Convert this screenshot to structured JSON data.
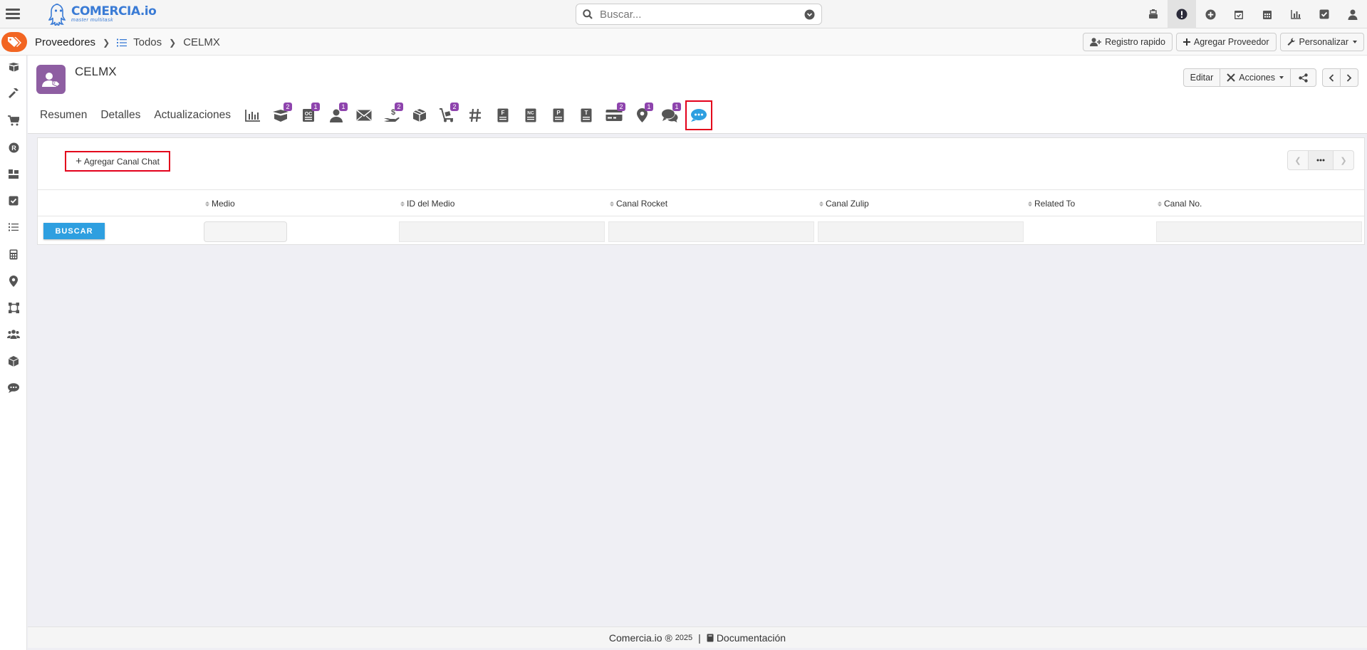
{
  "app": {
    "logo_name": "COMERCIA.io",
    "logo_tagline": "master multitask"
  },
  "search": {
    "placeholder": "Buscar..."
  },
  "top_icons": [
    "cash-register-icon",
    "alert-icon",
    "plus-circle-icon",
    "calendar-check-icon",
    "calendar-icon",
    "chart-icon",
    "checkbox-icon",
    "user-icon"
  ],
  "breadcrumb": {
    "module": "Proveedores",
    "list": "Todos",
    "record": "CELMX"
  },
  "actions": {
    "quick_register": "Registro rapido",
    "add_supplier": "Agregar Proveedor",
    "customize": "Personalizar"
  },
  "record": {
    "title": "CELMX",
    "edit": "Editar",
    "actions": "Acciones"
  },
  "tabs": {
    "summary": "Resumen",
    "details": "Detalles",
    "updates": "Actualizaciones",
    "icons": [
      {
        "name": "chart-icon",
        "badge": ""
      },
      {
        "name": "box-open-icon",
        "badge": "2"
      },
      {
        "name": "purchase-order-icon",
        "badge": "1"
      },
      {
        "name": "contact-icon",
        "badge": "1"
      },
      {
        "name": "envelope-icon",
        "badge": ""
      },
      {
        "name": "payment-hand-icon",
        "badge": "2"
      },
      {
        "name": "package-icon",
        "badge": ""
      },
      {
        "name": "dolly-icon",
        "badge": "2"
      },
      {
        "name": "hashtag-icon",
        "badge": ""
      },
      {
        "name": "invoice-f-icon",
        "badge": ""
      },
      {
        "name": "credit-note-nc-icon",
        "badge": ""
      },
      {
        "name": "document-p-icon",
        "badge": ""
      },
      {
        "name": "document-t-icon",
        "badge": ""
      },
      {
        "name": "credit-card-icon",
        "badge": "2"
      },
      {
        "name": "map-marker-icon",
        "badge": "1"
      },
      {
        "name": "comments-icon",
        "badge": "1"
      },
      {
        "name": "chat-channel-icon",
        "badge": ""
      }
    ]
  },
  "panel": {
    "add_button": "Agregar Canal Chat",
    "columns": [
      "Medio",
      "ID del Medio",
      "Canal Rocket",
      "Canal Zulip",
      "Related To",
      "Canal No."
    ],
    "search_button": "BUSCAR"
  },
  "footer": {
    "brand": "Comercia.io ®",
    "year": "2025",
    "docs": "Documentación"
  },
  "colors": {
    "accent_orange": "#f26522",
    "badge_purple": "#8e44ad",
    "avatar_purple": "#8e5ea2",
    "primary_blue": "#2e9fe0",
    "highlight_red": "#e3001b"
  }
}
